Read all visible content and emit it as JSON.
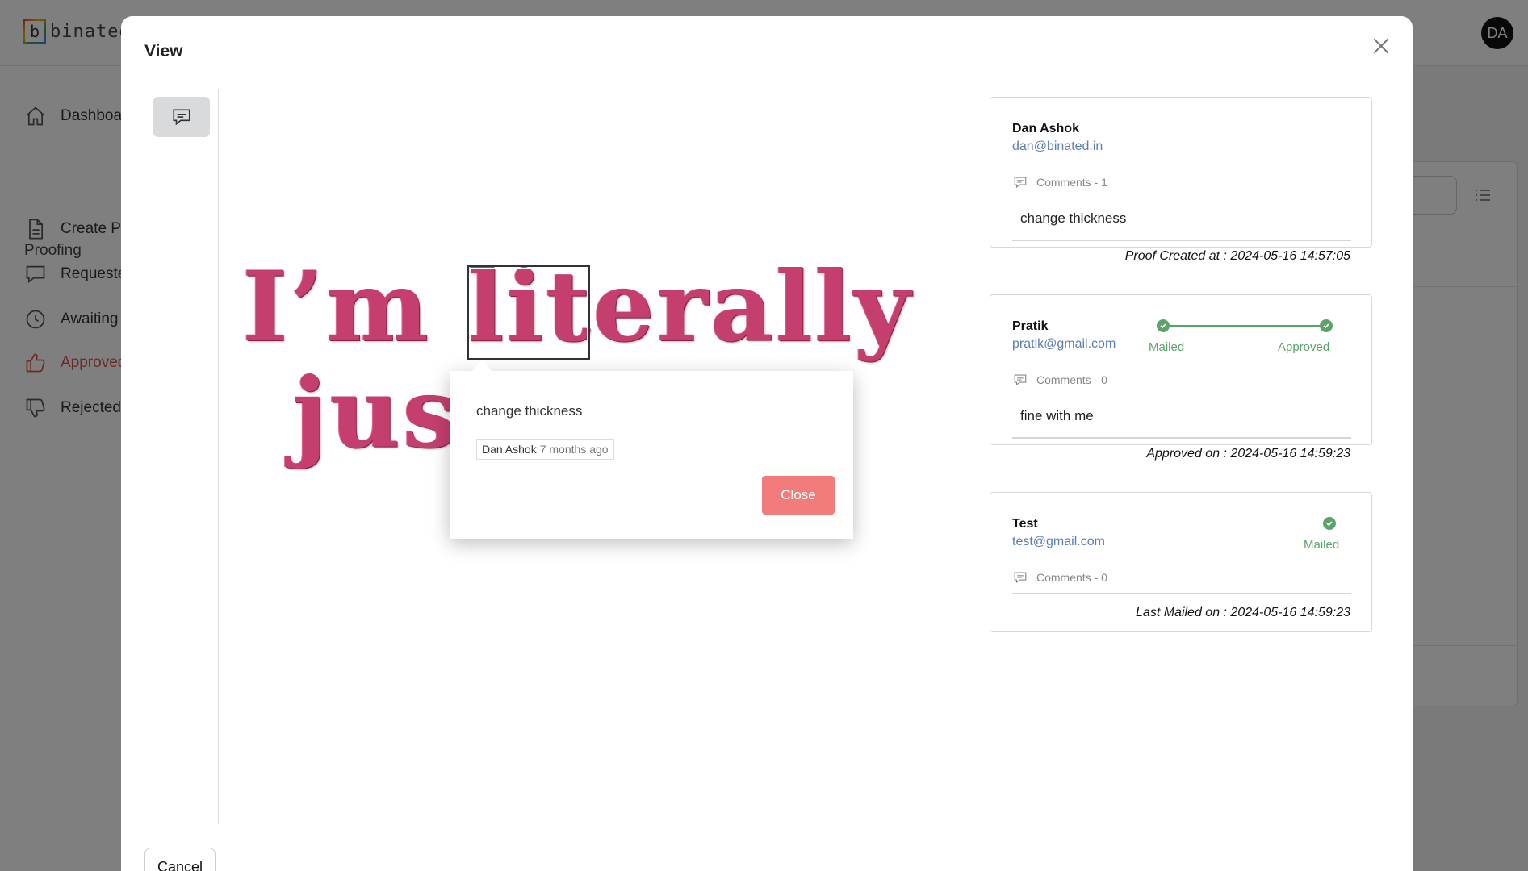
{
  "app": {
    "logo_letter": "b",
    "logo_text": "binated",
    "avatar_initials": "DA"
  },
  "sidebar": {
    "section_title": "Proofing",
    "items": [
      {
        "label": "Dashboard",
        "icon": "home-icon"
      },
      {
        "label": "Create Proof",
        "icon": "document-icon"
      },
      {
        "label": "Requested",
        "icon": "chat-icon"
      },
      {
        "label": "Awaiting",
        "icon": "clock-icon"
      },
      {
        "label": "Approved",
        "icon": "thumbs-up-icon",
        "active": true
      },
      {
        "label": "Rejected",
        "icon": "thumbs-down-icon"
      }
    ]
  },
  "modal": {
    "title": "View",
    "cancel_label": "Cancel",
    "design": {
      "line1": "I’m literally",
      "line2": "just   al"
    }
  },
  "comment_popup": {
    "text": "change thickness",
    "author": "Dan Ashok",
    "time": "7 months ago",
    "close_label": "Close"
  },
  "reviewers": [
    {
      "name": "Dan Ashok",
      "email": "dan@binated.in",
      "comments_label": "Comments - 1",
      "comment": "change thickness",
      "footer": "Proof Created at : 2024-05-16 14:57:05"
    },
    {
      "name": "Pratik",
      "email": "pratik@gmail.com",
      "comments_label": "Comments - 0",
      "comment": "fine with me",
      "footer": "Approved on : 2024-05-16 14:59:23",
      "steps": [
        "Mailed",
        "Approved"
      ]
    },
    {
      "name": "Test",
      "email": "test@gmail.com",
      "comments_label": "Comments - 0",
      "footer": "Last Mailed on : 2024-05-16 14:59:23",
      "steps": [
        "Mailed"
      ]
    }
  ],
  "colors": {
    "accent": "#d9534f",
    "success": "#5aa468",
    "link": "#5b7fb3",
    "close_button": "#f27b7b"
  }
}
